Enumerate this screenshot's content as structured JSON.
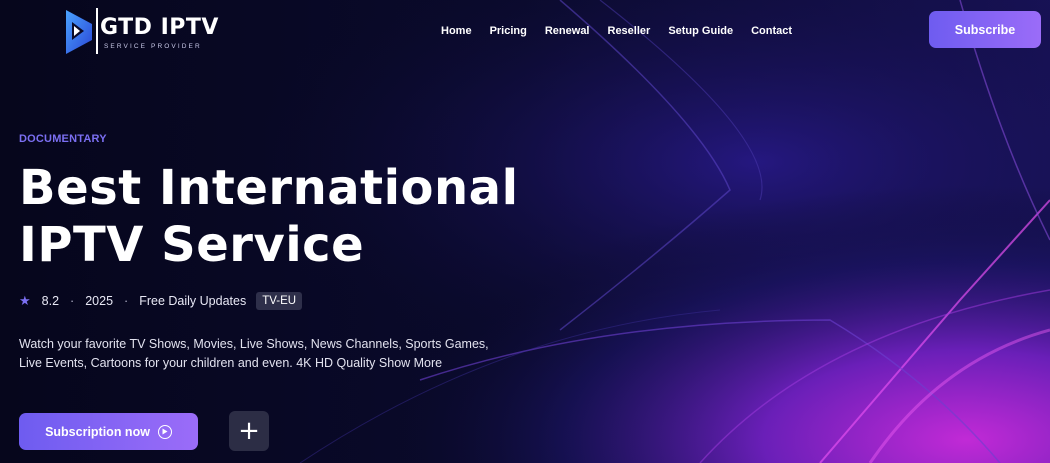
{
  "brand": {
    "name": "GTD IPTV",
    "tagline": "SERVICE PROVIDER",
    "logo_icon": "play-logo-icon"
  },
  "nav": {
    "items": [
      "Home",
      "Pricing",
      "Renewal",
      "Reseller",
      "Setup Guide",
      "Contact"
    ]
  },
  "header": {
    "subscribe_label": "Subscribe"
  },
  "hero": {
    "eyebrow": "DOCUMENTARY",
    "title_line1": "Best International",
    "title_line2": "IPTV Service",
    "rating": "8.2",
    "year": "2025",
    "updates": "Free Daily Updates",
    "badge": "TV-EU",
    "description": "Watch your favorite TV Shows, Movies, Live Shows, News Channels, Sports Games, Live Events, Cartoons for your children and even. 4K HD Quality Show More",
    "cta_label": "Subscription now",
    "add_label": "+"
  },
  "colors": {
    "accent": "#7b6ff2",
    "button_gradient_start": "#6e5cf0",
    "button_gradient_end": "#9b6cf8",
    "background": "#0a0a28"
  }
}
